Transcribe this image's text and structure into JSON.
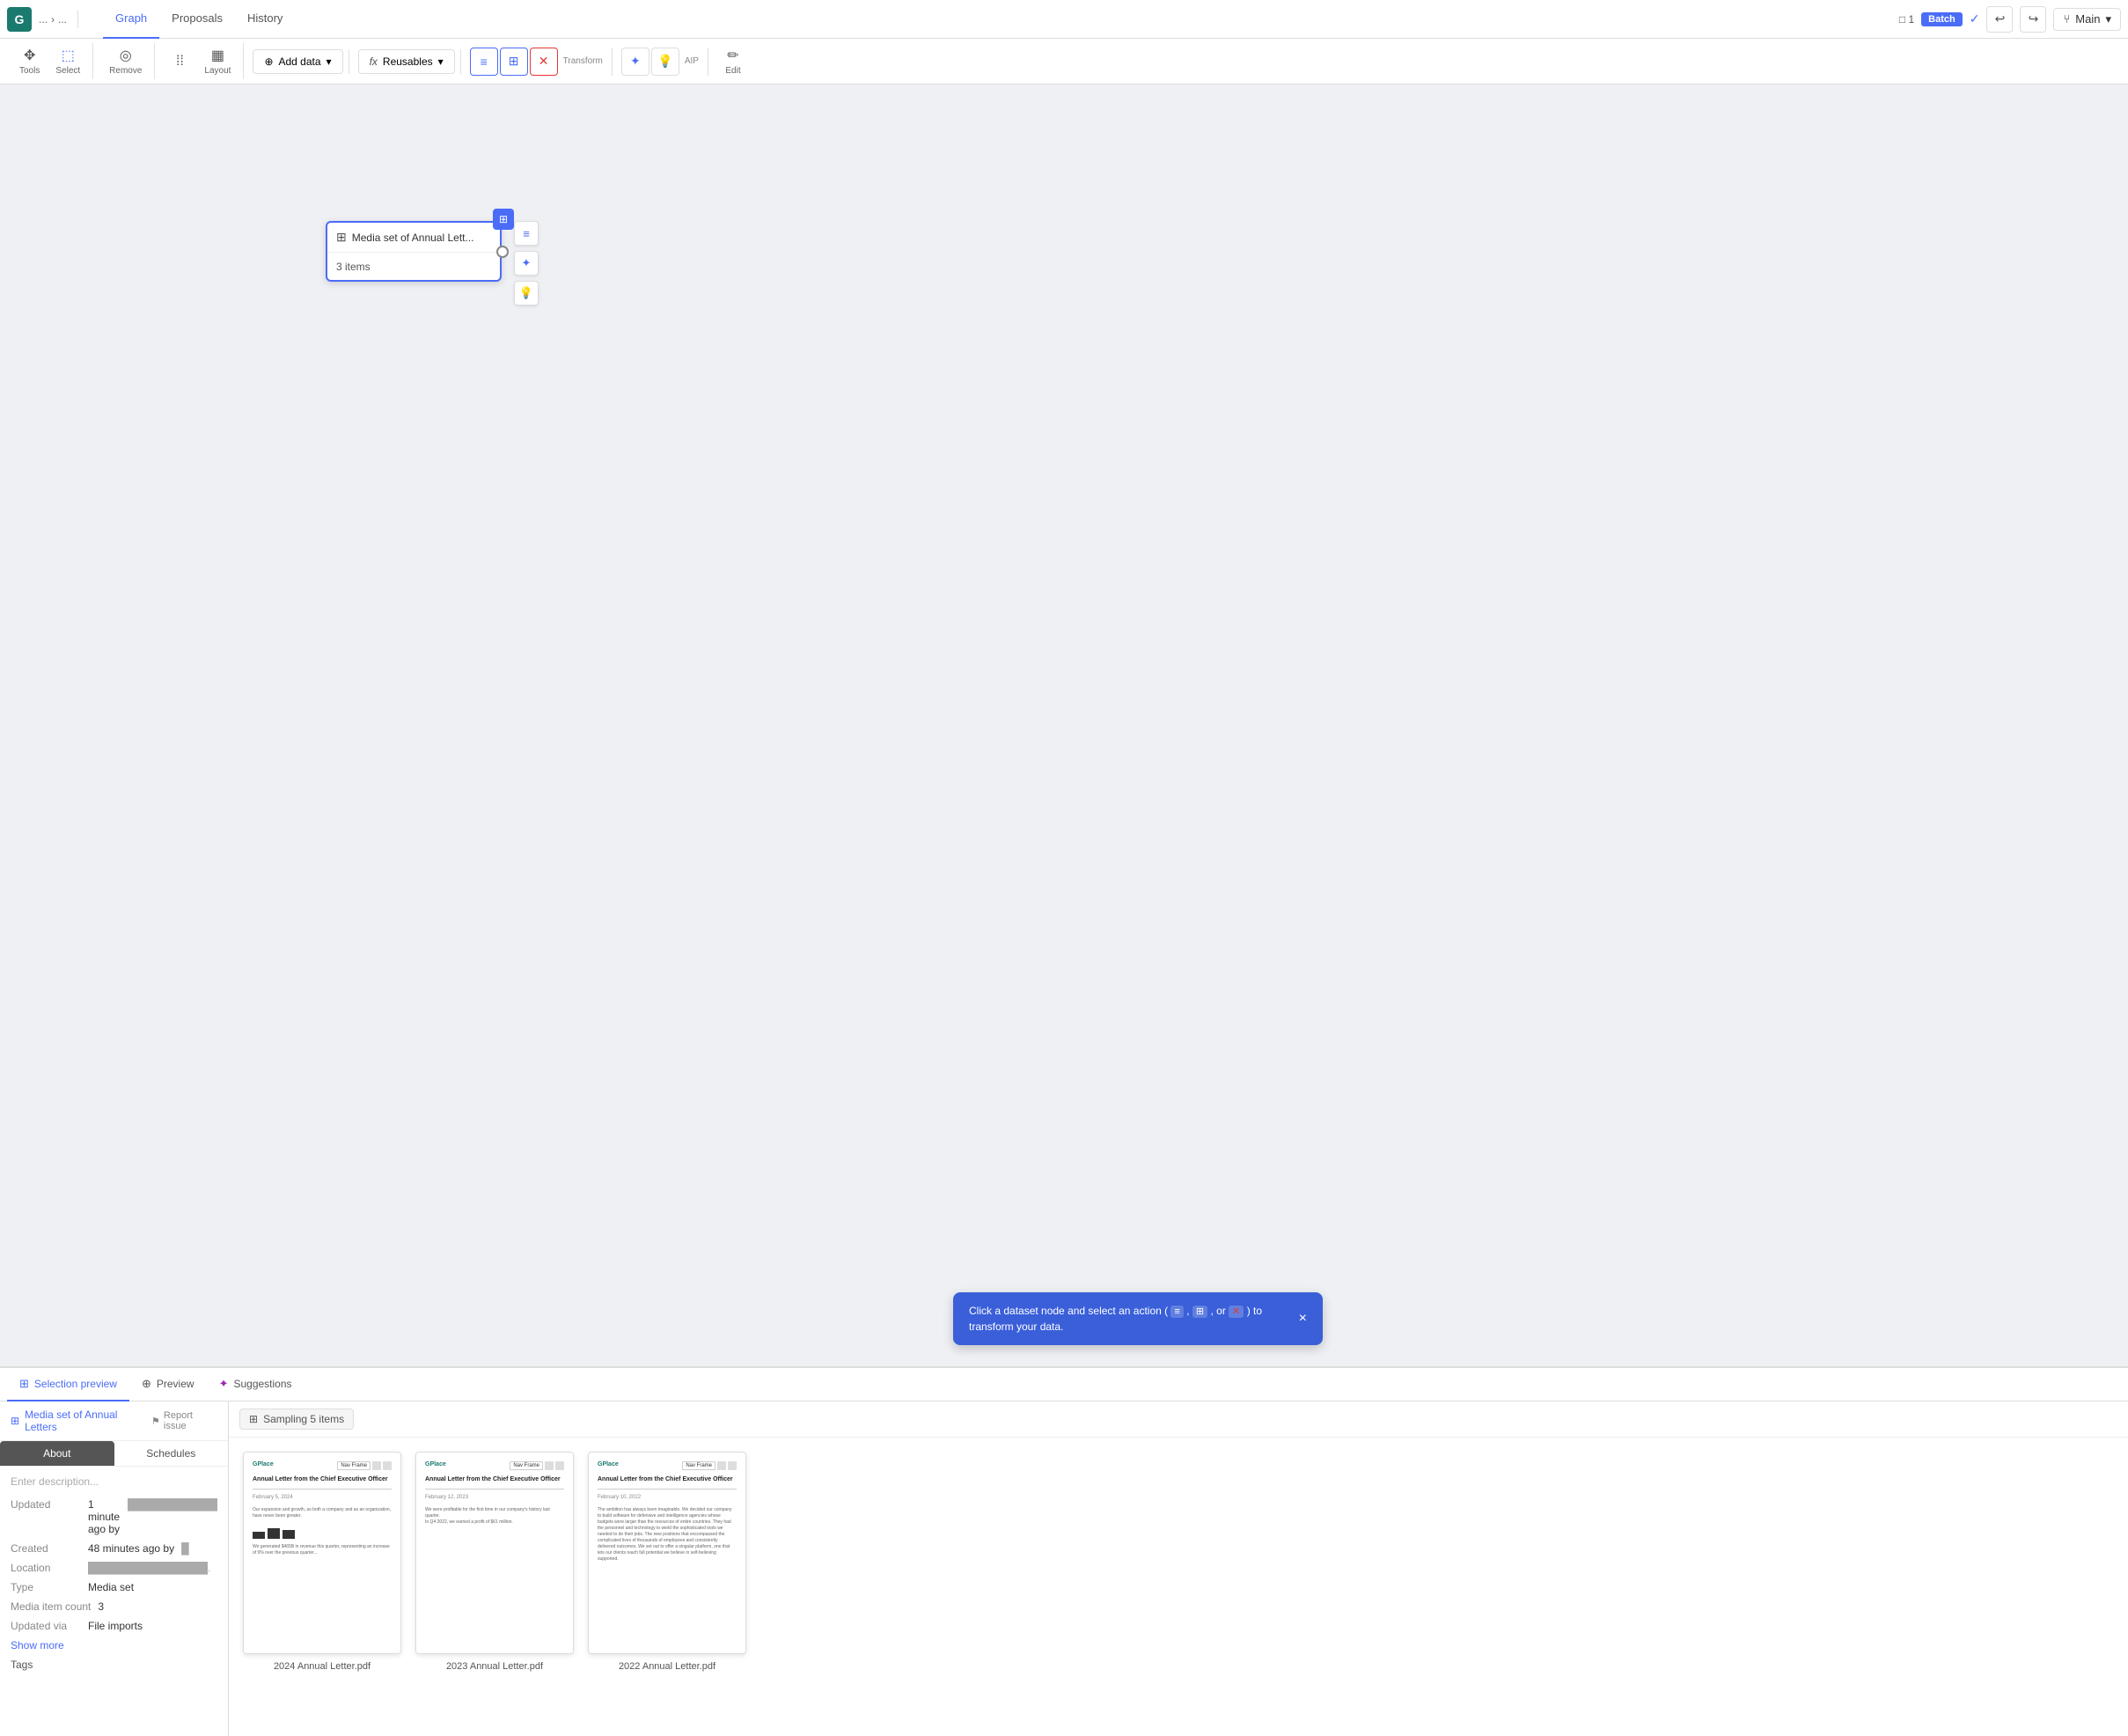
{
  "app": {
    "logo": "G",
    "logo_bg": "#1a7a6e"
  },
  "breadcrumb": {
    "parts": [
      "...",
      "›",
      "..."
    ]
  },
  "top_tabs": [
    {
      "label": "Graph",
      "active": true
    },
    {
      "label": "Proposals",
      "active": false
    },
    {
      "label": "History",
      "active": false
    }
  ],
  "top_right": {
    "node_count": "1",
    "batch_label": "Batch",
    "undo_icon": "↩",
    "redo_icon": "↪",
    "branch_label": "Main",
    "branch_icon": "⑂"
  },
  "toolbar": {
    "tools_group": [
      {
        "icon": "✥",
        "label": "Tools"
      },
      {
        "icon": "⬚",
        "label": "Select"
      }
    ],
    "remove_icon": "◎",
    "remove_label": "Remove",
    "layout_icons": [
      "⁞⁞",
      "▦"
    ],
    "layout_label": "Layout",
    "add_data_label": "Add data",
    "add_data_icon": "⊕",
    "reusables_label": "Reusables",
    "reusables_icon": "fx",
    "transform_label": "Transform",
    "transform_icons": [
      "≡",
      "⊞",
      "✕"
    ],
    "aip_label": "AIP",
    "aip_icons": [
      "✦",
      "💡"
    ],
    "edit_label": "Edit",
    "edit_icon": "✏"
  },
  "node": {
    "title": "Media set of Annual Lett...",
    "icon": "⊞",
    "count_label": "3 items",
    "action_icons": [
      "≡",
      "✦",
      "💡"
    ]
  },
  "tooltip": {
    "text": "Click a dataset node and select an action (",
    "suffix": ") to transform your data.",
    "close_icon": "×"
  },
  "bottom_tabs": [
    {
      "label": "Selection preview",
      "icon": "⊞",
      "active": true
    },
    {
      "label": "Preview",
      "icon": "⊕",
      "active": false
    },
    {
      "label": "Suggestions",
      "icon": "✦",
      "active": false
    }
  ],
  "left_panel": {
    "dataset_name": "Media set of Annual Letters",
    "dataset_icon": "⊞",
    "report_link": "Report issue",
    "report_icon": "⚑",
    "sub_tabs": [
      "About",
      "Schedules"
    ],
    "active_sub_tab": "About",
    "placeholder": "Enter description...",
    "updated": "1 minute ago by",
    "updated_user": "████████████",
    "created": "48 minutes ago by",
    "created_user": "█",
    "location": "████████████████.",
    "type": "Media set",
    "media_item_count": "3",
    "updated_via": "File imports",
    "show_more": "Show more",
    "tags_label": "Tags"
  },
  "right_panel": {
    "sampling_label": "Sampling 5 items",
    "sampling_icon": "⊞",
    "items": [
      {
        "filename": "2024 Annual Letter.pdf",
        "title": "Annual Letter from the Chief Executive Officer",
        "date": "February 5, 2024",
        "has_chart": true
      },
      {
        "filename": "2023 Annual Letter.pdf",
        "title": "Annual Letter from the Chief Executive Officer",
        "date": "February 12, 2023",
        "has_chart": false
      },
      {
        "filename": "2022 Annual Letter.pdf",
        "title": "Annual Letter from the Chief Executive Officer",
        "date": "February 10, 2022",
        "has_chart": false
      }
    ]
  }
}
